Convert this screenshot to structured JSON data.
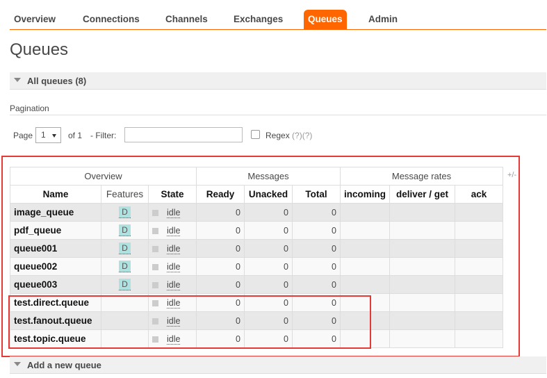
{
  "nav": {
    "tabs": [
      {
        "label": "Overview"
      },
      {
        "label": "Connections"
      },
      {
        "label": "Channels"
      },
      {
        "label": "Exchanges"
      },
      {
        "label": "Queues",
        "active": true
      },
      {
        "label": "Admin"
      }
    ]
  },
  "page_title": "Queues",
  "all_queues_label": "All queues (8)",
  "pagination": {
    "title": "Pagination",
    "page_label": "Page",
    "page_value": "1",
    "of_label": "of 1",
    "filter_label": "- Filter:",
    "filter_value": "",
    "regex_label": "Regex",
    "regex_help": "(?)(?)"
  },
  "table": {
    "groups": [
      "Overview",
      "Messages",
      "Message rates"
    ],
    "columns": [
      "Name",
      "Features",
      "State",
      "Ready",
      "Unacked",
      "Total",
      "incoming",
      "deliver / get",
      "ack"
    ],
    "plus_minus": "+/-",
    "rows": [
      {
        "name": "image_queue",
        "feature": "D",
        "state": "idle",
        "ready": "0",
        "unacked": "0",
        "total": "0"
      },
      {
        "name": "pdf_queue",
        "feature": "D",
        "state": "idle",
        "ready": "0",
        "unacked": "0",
        "total": "0"
      },
      {
        "name": "queue001",
        "feature": "D",
        "state": "idle",
        "ready": "0",
        "unacked": "0",
        "total": "0"
      },
      {
        "name": "queue002",
        "feature": "D",
        "state": "idle",
        "ready": "0",
        "unacked": "0",
        "total": "0"
      },
      {
        "name": "queue003",
        "feature": "D",
        "state": "idle",
        "ready": "0",
        "unacked": "0",
        "total": "0"
      },
      {
        "name": "test.direct.queue",
        "feature": "",
        "state": "idle",
        "ready": "0",
        "unacked": "0",
        "total": "0"
      },
      {
        "name": "test.fanout.queue",
        "feature": "",
        "state": "idle",
        "ready": "0",
        "unacked": "0",
        "total": "0"
      },
      {
        "name": "test.topic.queue",
        "feature": "",
        "state": "idle",
        "ready": "0",
        "unacked": "0",
        "total": "0"
      }
    ]
  },
  "add_queue_label": "Add a new queue",
  "colors": {
    "accent": "#ff6600",
    "highlight": "#e53935",
    "feature_badge": "#aee2e0"
  }
}
